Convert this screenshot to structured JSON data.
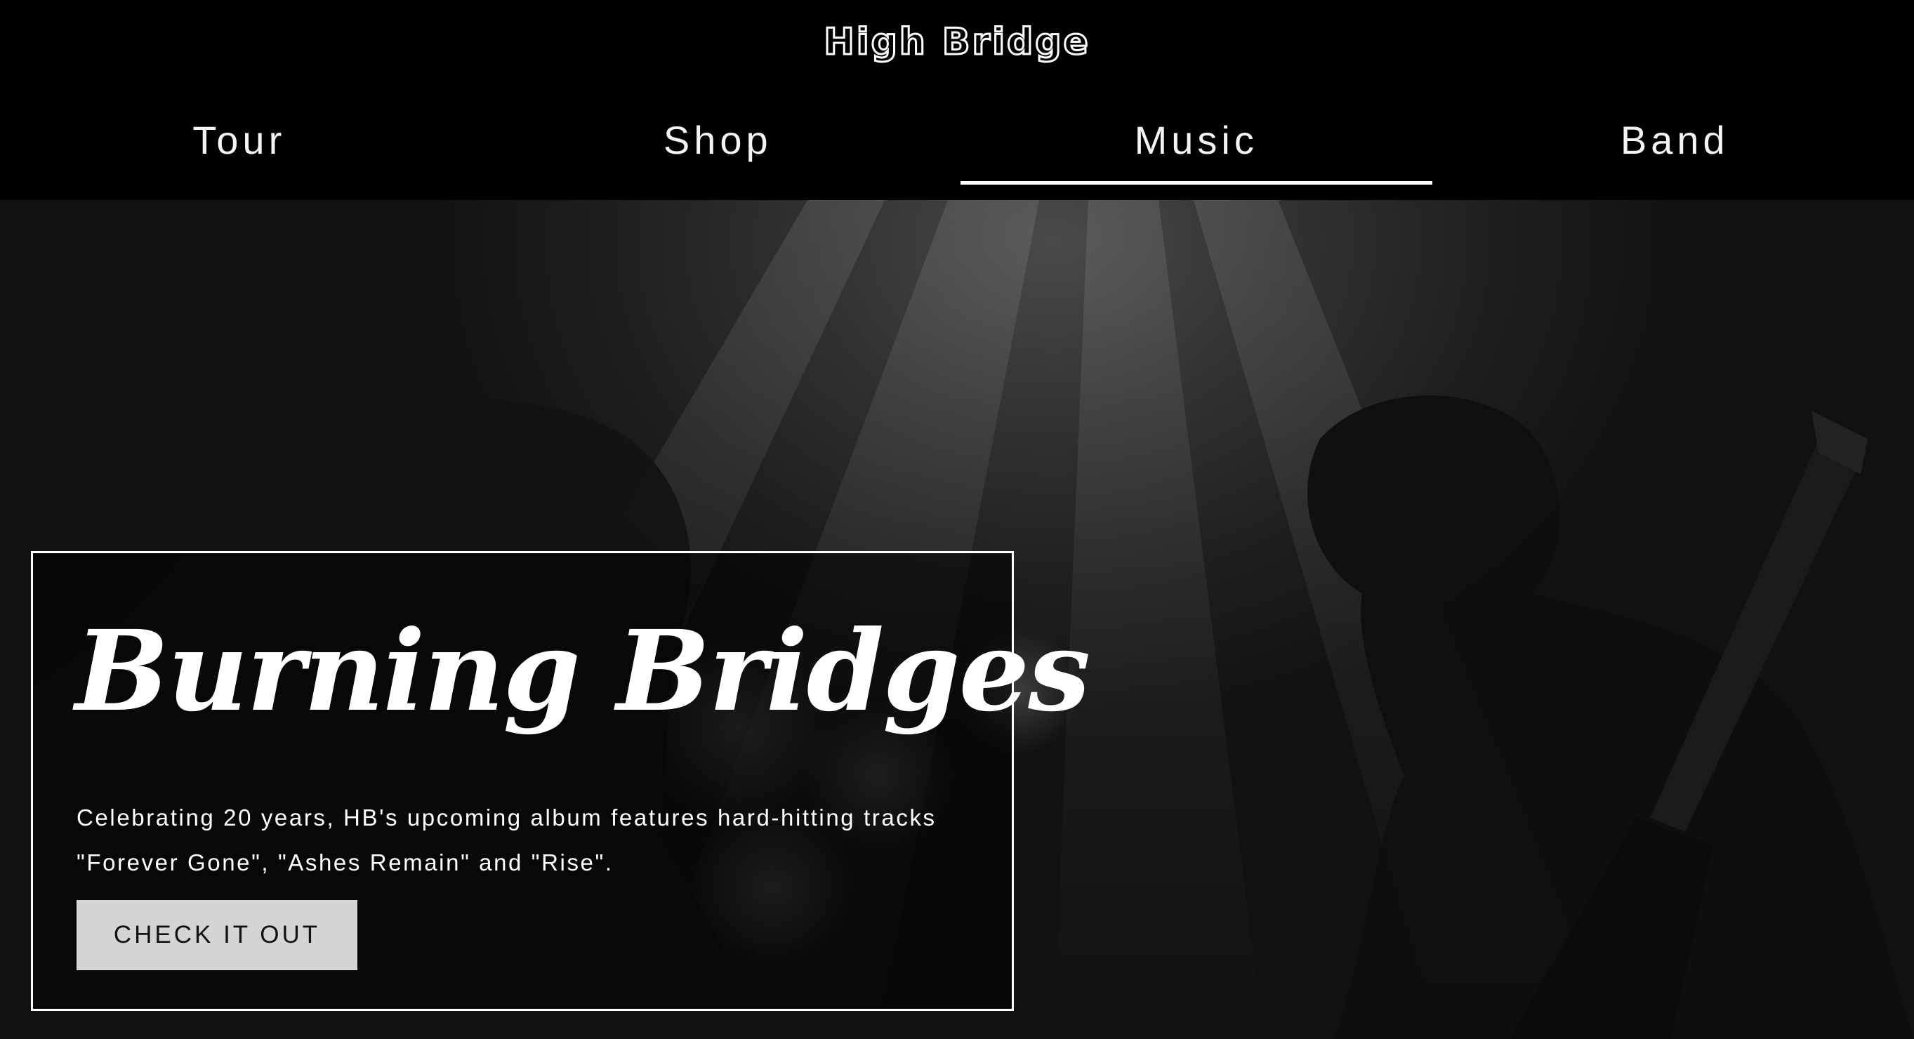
{
  "header": {
    "brand": "High Bridge",
    "nav": [
      {
        "label": "Tour",
        "active": false
      },
      {
        "label": "Shop",
        "active": false
      },
      {
        "label": "Music",
        "active": true
      },
      {
        "label": "Band",
        "active": false
      }
    ]
  },
  "hero": {
    "title": "Burning Bridges",
    "description_line1": "Celebrating 20 years, HB's upcoming album features hard-hitting tracks",
    "description_line2": "\"Forever Gone\", \"Ashes Remain\" and \"Rise\".",
    "button_label": "CHECK IT OUT"
  },
  "colors": {
    "background": "#000000",
    "text": "#ffffff",
    "button_bg": "#d4d4d4",
    "button_text": "#111111"
  }
}
